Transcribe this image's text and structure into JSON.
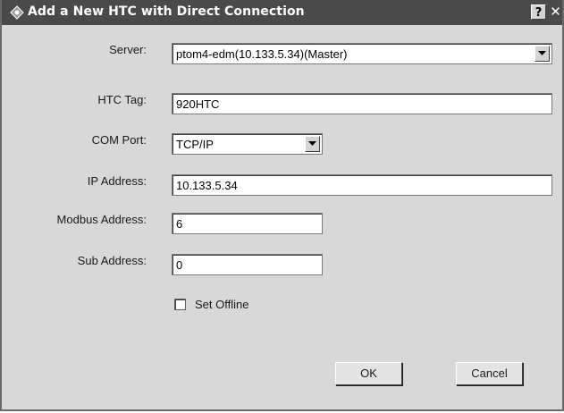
{
  "window": {
    "title": "Add a New HTC with Direct Connection",
    "help_label": "?",
    "close_label": "✕"
  },
  "form": {
    "server": {
      "label": "Server:",
      "value": "ptom4-edm(10.133.5.34)(Master)"
    },
    "htc_tag": {
      "label": "HTC Tag:",
      "value": "920HTC"
    },
    "com_port": {
      "label": "COM Port:",
      "value": "TCP/IP"
    },
    "ip_address": {
      "label": "IP Address:",
      "value": "10.133.5.34"
    },
    "modbus_address": {
      "label": "Modbus Address:",
      "value": "6"
    },
    "sub_address": {
      "label": "Sub Address:",
      "value": "0"
    },
    "set_offline": {
      "label": "Set Offline",
      "checked": false
    }
  },
  "buttons": {
    "ok": "OK",
    "cancel": "Cancel"
  },
  "icons": {
    "title": "app-diamond-icon",
    "dropdown": "chevron-down-icon"
  }
}
